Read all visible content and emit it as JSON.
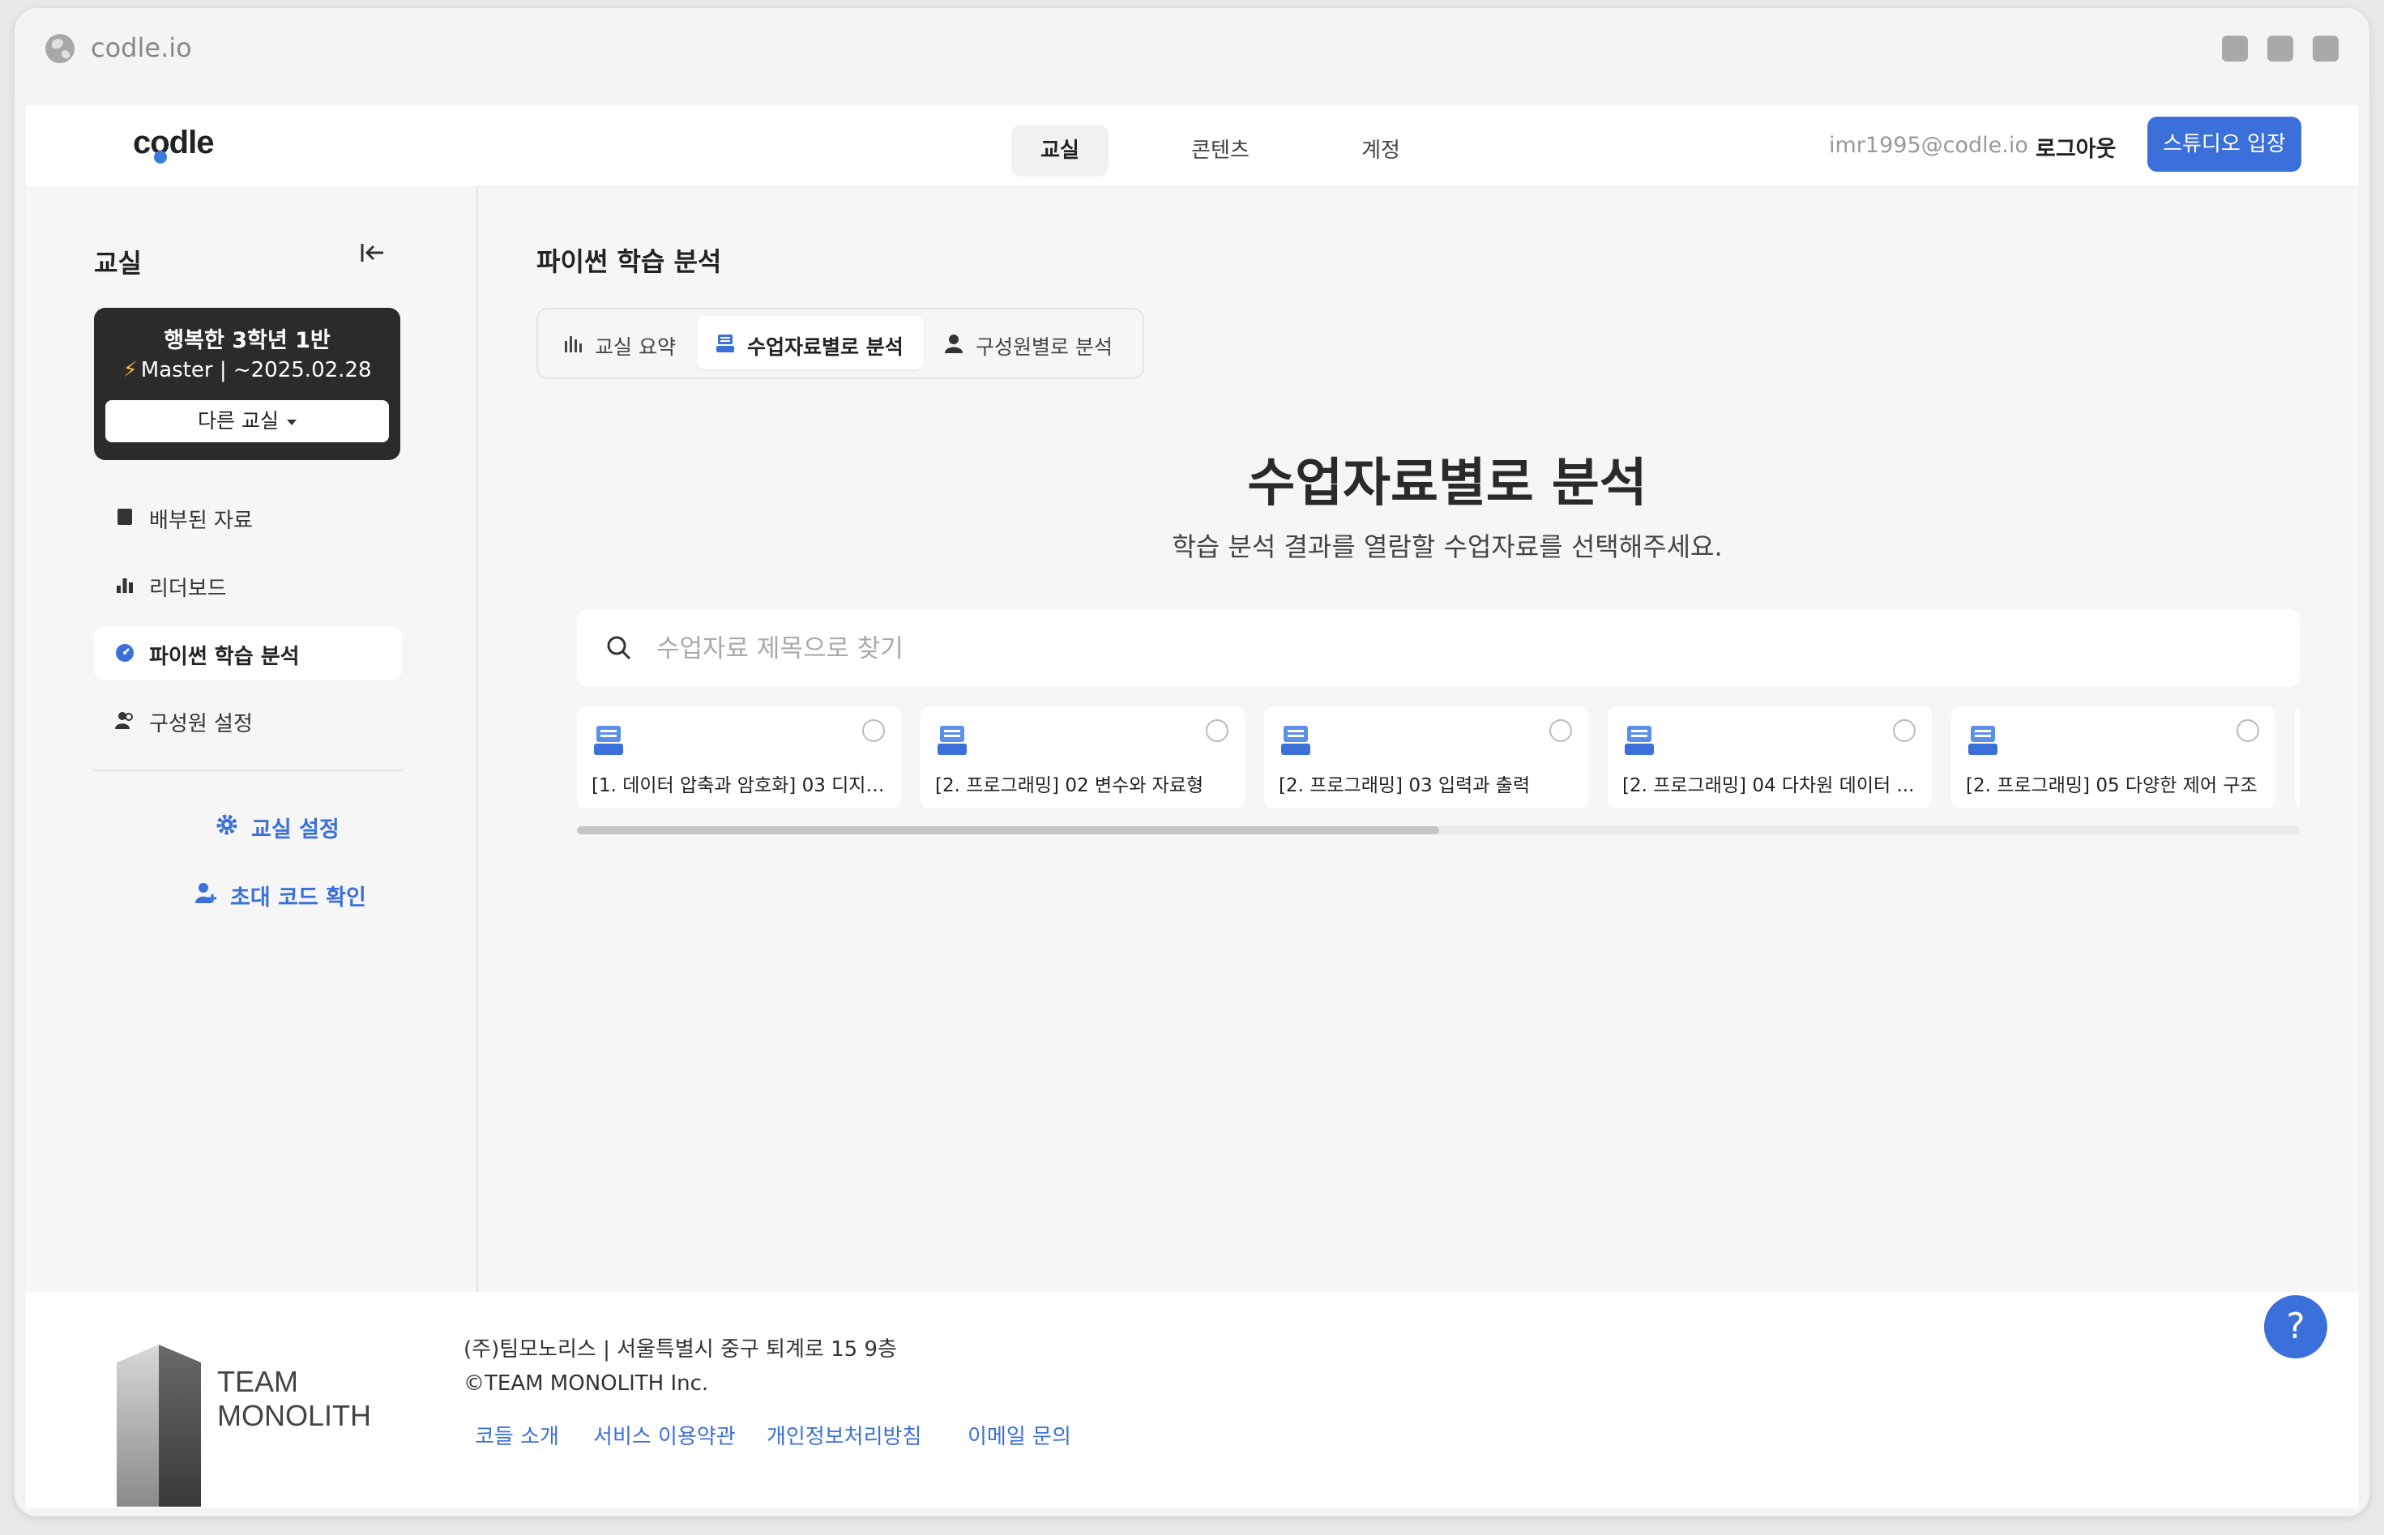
{
  "browser": {
    "url": "codle.io"
  },
  "header": {
    "logo": "codle",
    "nav": [
      "교실",
      "콘텐츠",
      "계정"
    ],
    "email": "imr1995@codle.io",
    "logout": "로그아웃",
    "studio": "스튜디오 입장"
  },
  "sidebar": {
    "title": "교실",
    "class_name": "행복한 3학년 1반",
    "class_plan": "Master | ~2025.02.28",
    "other_class": "다른 교실",
    "items": [
      "배부된 자료",
      "리더보드",
      "파이썬 학습 분석",
      "구성원 설정"
    ],
    "settings": "교실 설정",
    "invite": "초대 코드 확인"
  },
  "main": {
    "title": "파이썬 학습 분석",
    "tabs": [
      "교실 요약",
      "수업자료별로 분석",
      "구성원별로 분석"
    ],
    "heading": "수업자료별로 분석",
    "subtitle": "학습 분석 결과를 열람할 수업자료를 선택해주세요.",
    "search_placeholder": "수업자료 제목으로 찾기",
    "cards": [
      "[1. 데이터 압축과 암호화] 03 디지털...",
      "[2. 프로그래밍] 02 변수와 자료형",
      "[2. 프로그래밍] 03 입력과 출력",
      "[2. 프로그래밍] 04 다차원 데이터 ...",
      "[2. 프로그래밍] 05 다양한 제어 구조"
    ]
  },
  "footer": {
    "team_line1": "TEAM",
    "team_line2": "MONOLITH",
    "address": "(주)팀모노리스 | 서울특별시 중구 퇴계로 15 9층",
    "copyright": "©TEAM MONOLITH Inc.",
    "links": [
      "코들 소개",
      "서비스 이용약관",
      "개인정보처리방침",
      "이메일 문의"
    ]
  },
  "help": "?",
  "colors": {
    "accent": "#3b6fd9",
    "dark_card": "#2b2b2b"
  }
}
